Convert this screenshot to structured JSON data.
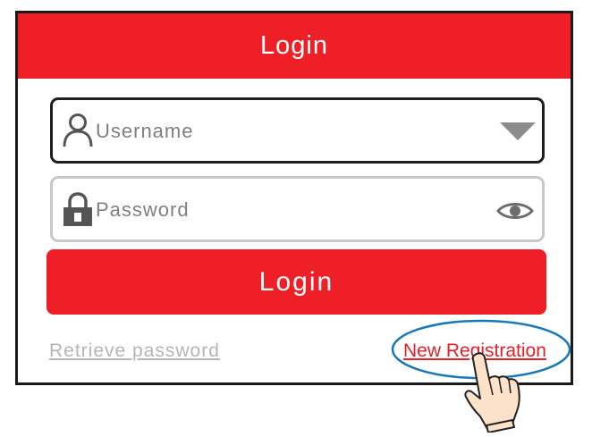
{
  "header": {
    "title": "Login"
  },
  "username": {
    "placeholder": "Username",
    "left_icon": "user-icon",
    "right_icon": "dropdown-triangle-icon"
  },
  "password": {
    "placeholder": "Password",
    "left_icon": "lock-icon",
    "right_icon": "eye-icon"
  },
  "login_button": {
    "label": "Login"
  },
  "links": {
    "retrieve_password": "Retrieve  password",
    "new_registration": "New Registration"
  },
  "annotation": {
    "highlight": "ellipse-highlight",
    "pointer": "pointing-hand-icon"
  },
  "colors": {
    "accent": "#ee1f26",
    "highlight_ring": "#1a78b8",
    "link_muted": "#b5b5b5"
  }
}
